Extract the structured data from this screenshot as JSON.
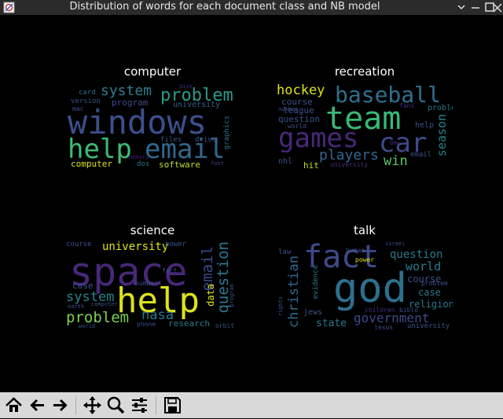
{
  "window": {
    "title": "Distribution of words for each document class and NB model",
    "controls": [
      "minimize",
      "maximize",
      "close"
    ]
  },
  "panels": [
    {
      "title": "computer",
      "words": [
        {
          "text": "windows",
          "color": "#3b4f8c"
        },
        {
          "text": "help",
          "color": "#3dbc74"
        },
        {
          "text": "email",
          "color": "#31688e"
        },
        {
          "text": "problem",
          "color": "#2a9a8a"
        },
        {
          "text": "system",
          "color": "#2e7e8e"
        },
        {
          "text": "program",
          "color": "#3e4a89"
        },
        {
          "text": "university",
          "color": "#35608d"
        },
        {
          "text": "software",
          "color": "#bddf26"
        },
        {
          "text": "computer",
          "color": "#dde318"
        },
        {
          "text": "card",
          "color": "#2f6c8e"
        },
        {
          "text": "version",
          "color": "#3b528b"
        },
        {
          "text": "mac",
          "color": "#3b528b"
        },
        {
          "text": "files",
          "color": "#3b528b"
        },
        {
          "text": "drive",
          "color": "#3b528b"
        },
        {
          "text": "graphics",
          "color": "#2c718e"
        },
        {
          "text": "dos",
          "color": "#2a788e"
        },
        {
          "text": "disk",
          "color": "#472f7d"
        },
        {
          "text": "memory",
          "color": "#482173"
        },
        {
          "text": "font",
          "color": "#433e85"
        }
      ]
    },
    {
      "title": "recreation",
      "words": [
        {
          "text": "team",
          "color": "#38b977"
        },
        {
          "text": "games",
          "color": "#482878"
        },
        {
          "text": "car",
          "color": "#3e4a89"
        },
        {
          "text": "baseball",
          "color": "#2d708e"
        },
        {
          "text": "hockey",
          "color": "#dde318"
        },
        {
          "text": "players",
          "color": "#31688e"
        },
        {
          "text": "season",
          "color": "#25848e"
        },
        {
          "text": "win",
          "color": "#5cc863"
        },
        {
          "text": "course",
          "color": "#3b528b"
        },
        {
          "text": "league",
          "color": "#3b528b"
        },
        {
          "text": "question",
          "color": "#3b528b"
        },
        {
          "text": "problem",
          "color": "#2a788e"
        },
        {
          "text": "help",
          "color": "#3b528b"
        },
        {
          "text": "email",
          "color": "#3b528b"
        },
        {
          "text": "nhl",
          "color": "#3b528b"
        },
        {
          "text": "hit",
          "color": "#bddf26"
        },
        {
          "text": "fans",
          "color": "#472f7d"
        },
        {
          "text": "bmw",
          "color": "#472f7d"
        },
        {
          "text": "world",
          "color": "#3b528b"
        },
        {
          "text": "number",
          "color": "#3b528b"
        },
        {
          "text": "university",
          "color": "#472f7d"
        }
      ]
    },
    {
      "title": "science",
      "words": [
        {
          "text": "space",
          "color": "#482878"
        },
        {
          "text": "help",
          "color": "#dde318"
        },
        {
          "text": "university",
          "color": "#dde318"
        },
        {
          "text": "email",
          "color": "#3e4a89"
        },
        {
          "text": "question",
          "color": "#2a788e"
        },
        {
          "text": "system",
          "color": "#25848e"
        },
        {
          "text": "problem",
          "color": "#7ad151"
        },
        {
          "text": "nasa",
          "color": "#2a788e"
        },
        {
          "text": "research",
          "color": "#2a788e"
        },
        {
          "text": "data",
          "color": "#dde318"
        },
        {
          "text": "case",
          "color": "#3b528b"
        },
        {
          "text": "course",
          "color": "#3b528b"
        },
        {
          "text": "power",
          "color": "#3b528b"
        },
        {
          "text": "number",
          "color": "#3b528b"
        },
        {
          "text": "fact",
          "color": "#3b528b"
        },
        {
          "text": "phone",
          "color": "#3b528b"
        },
        {
          "text": "computer",
          "color": "#3b528b"
        },
        {
          "text": "program",
          "color": "#3b528b"
        },
        {
          "text": "orbit",
          "color": "#3b528b"
        },
        {
          "text": "world",
          "color": "#3b528b"
        },
        {
          "text": "earth",
          "color": "#3b528b"
        }
      ]
    },
    {
      "title": "talk",
      "words": [
        {
          "text": "fact",
          "color": "#3e4a89"
        },
        {
          "text": "god",
          "color": "#2d708e"
        },
        {
          "text": "christian",
          "color": "#31688e"
        },
        {
          "text": "question",
          "color": "#2a788e"
        },
        {
          "text": "government",
          "color": "#3e4a89"
        },
        {
          "text": "world",
          "color": "#2a788e"
        },
        {
          "text": "course",
          "color": "#3b528b"
        },
        {
          "text": "case",
          "color": "#2a788e"
        },
        {
          "text": "religion",
          "color": "#2a788e"
        },
        {
          "text": "state",
          "color": "#2a788e"
        },
        {
          "text": "university",
          "color": "#3b528b"
        },
        {
          "text": "evidence",
          "color": "#2a788e"
        },
        {
          "text": "power",
          "color": "#dde318"
        },
        {
          "text": "jews",
          "color": "#3b528b"
        },
        {
          "text": "jesus",
          "color": "#3b528b"
        },
        {
          "text": "bible",
          "color": "#3b528b"
        },
        {
          "text": "law",
          "color": "#3b528b"
        },
        {
          "text": "human",
          "color": "#3b528b"
        },
        {
          "text": "israel",
          "color": "#3b528b"
        },
        {
          "text": "children",
          "color": "#472f7d"
        },
        {
          "text": "problem",
          "color": "#3b528b"
        },
        {
          "text": "rights",
          "color": "#3b528b"
        }
      ]
    }
  ],
  "toolbar": {
    "buttons": [
      {
        "name": "home-button",
        "icon": "home-icon"
      },
      {
        "name": "back-button",
        "icon": "arrow-left-icon"
      },
      {
        "name": "forward-button",
        "icon": "arrow-right-icon"
      },
      {
        "name": "pan-button",
        "icon": "move-icon"
      },
      {
        "name": "zoom-button",
        "icon": "magnifier-icon"
      },
      {
        "name": "subplots-button",
        "icon": "sliders-icon"
      },
      {
        "name": "save-button",
        "icon": "floppy-icon"
      }
    ]
  }
}
